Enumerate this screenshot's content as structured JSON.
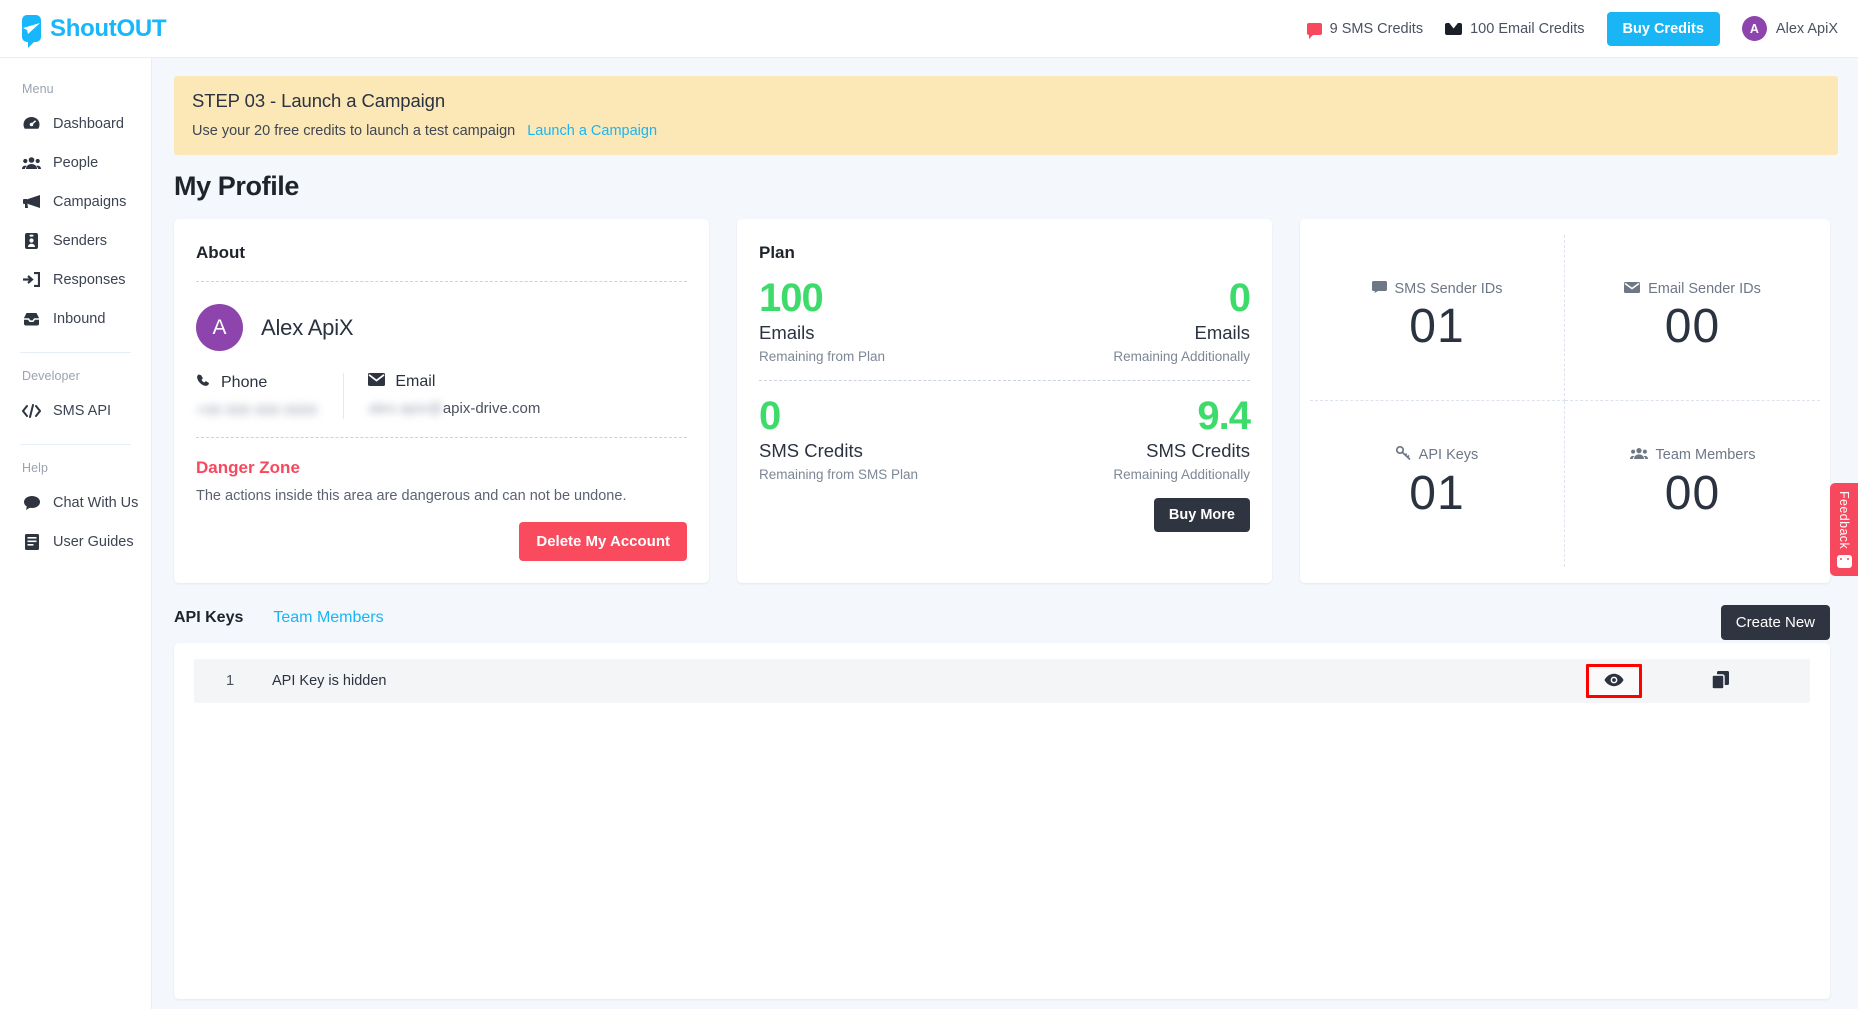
{
  "topbar": {
    "brand": "ShoutOUT",
    "sms_credits": "9 SMS Credits",
    "email_credits": "100 Email Credits",
    "buy_credits": "Buy Credits",
    "user_initial": "A",
    "user_name": "Alex ApiX"
  },
  "sidebar": {
    "group_menu": "Menu",
    "group_developer": "Developer",
    "group_help": "Help",
    "items": [
      {
        "label": "Dashboard",
        "icon": "dashboard-icon"
      },
      {
        "label": "People",
        "icon": "people-icon"
      },
      {
        "label": "Campaigns",
        "icon": "megaphone-icon"
      },
      {
        "label": "Senders",
        "icon": "id-card-icon"
      },
      {
        "label": "Responses",
        "icon": "sign-in-icon"
      },
      {
        "label": "Inbound",
        "icon": "inbox-icon"
      }
    ],
    "developer_items": [
      {
        "label": "SMS API",
        "icon": "code-icon"
      }
    ],
    "help_items": [
      {
        "label": "Chat With Us",
        "icon": "chat-icon"
      },
      {
        "label": "User Guides",
        "icon": "book-icon"
      }
    ]
  },
  "banner": {
    "title": "STEP 03 - Launch a Campaign",
    "subtitle": "Use your 20 free credits to launch a test campaign",
    "link": "Launch a Campaign"
  },
  "page": {
    "title": "My Profile"
  },
  "about": {
    "heading": "About",
    "avatar_initial": "A",
    "name": "Alex ApiX",
    "phone_label": "Phone",
    "phone_value": "+00 000 000 0000",
    "email_label": "Email",
    "email_value": "alex.apix@apix-drive.com",
    "danger_title": "Danger Zone",
    "danger_desc": "The actions inside this area are dangerous and can not be undone.",
    "delete_button": "Delete My Account"
  },
  "plan": {
    "heading": "Plan",
    "emails_plan_value": "100",
    "emails_plan_unit": "Emails",
    "emails_plan_note": "Remaining from Plan",
    "emails_add_value": "0",
    "emails_add_unit": "Emails",
    "emails_add_note": "Remaining Additionally",
    "sms_plan_value": "0",
    "sms_plan_unit": "SMS Credits",
    "sms_plan_note": "Remaining from SMS Plan",
    "sms_add_value": "9.4",
    "sms_add_unit": "SMS Credits",
    "sms_add_note": "Remaining Additionally",
    "buy_more": "Buy More"
  },
  "stats": [
    {
      "label": "SMS Sender IDs",
      "value": "01",
      "icon": "chat-bubble-icon"
    },
    {
      "label": "Email Sender IDs",
      "value": "00",
      "icon": "envelope-icon"
    },
    {
      "label": "API Keys",
      "value": "01",
      "icon": "key-icon"
    },
    {
      "label": "Team Members",
      "value": "00",
      "icon": "users-icon"
    }
  ],
  "tabs": {
    "api_keys": "API Keys",
    "team_members": "Team Members",
    "create_new": "Create New"
  },
  "api_key_row": {
    "index": "1",
    "value": "API Key is hidden",
    "reveal_icon": "eye-icon",
    "copy_icon": "copy-icon"
  },
  "feedback": {
    "label": "Feedback"
  },
  "colors": {
    "brand_blue": "#19b5f5",
    "danger_red": "#f8485e",
    "green": "#3ddc6a",
    "avatar_purple": "#8e44ad",
    "banner_yellow": "#fce8b6",
    "dark": "#2e3440",
    "highlight_red": "#ff0000"
  }
}
